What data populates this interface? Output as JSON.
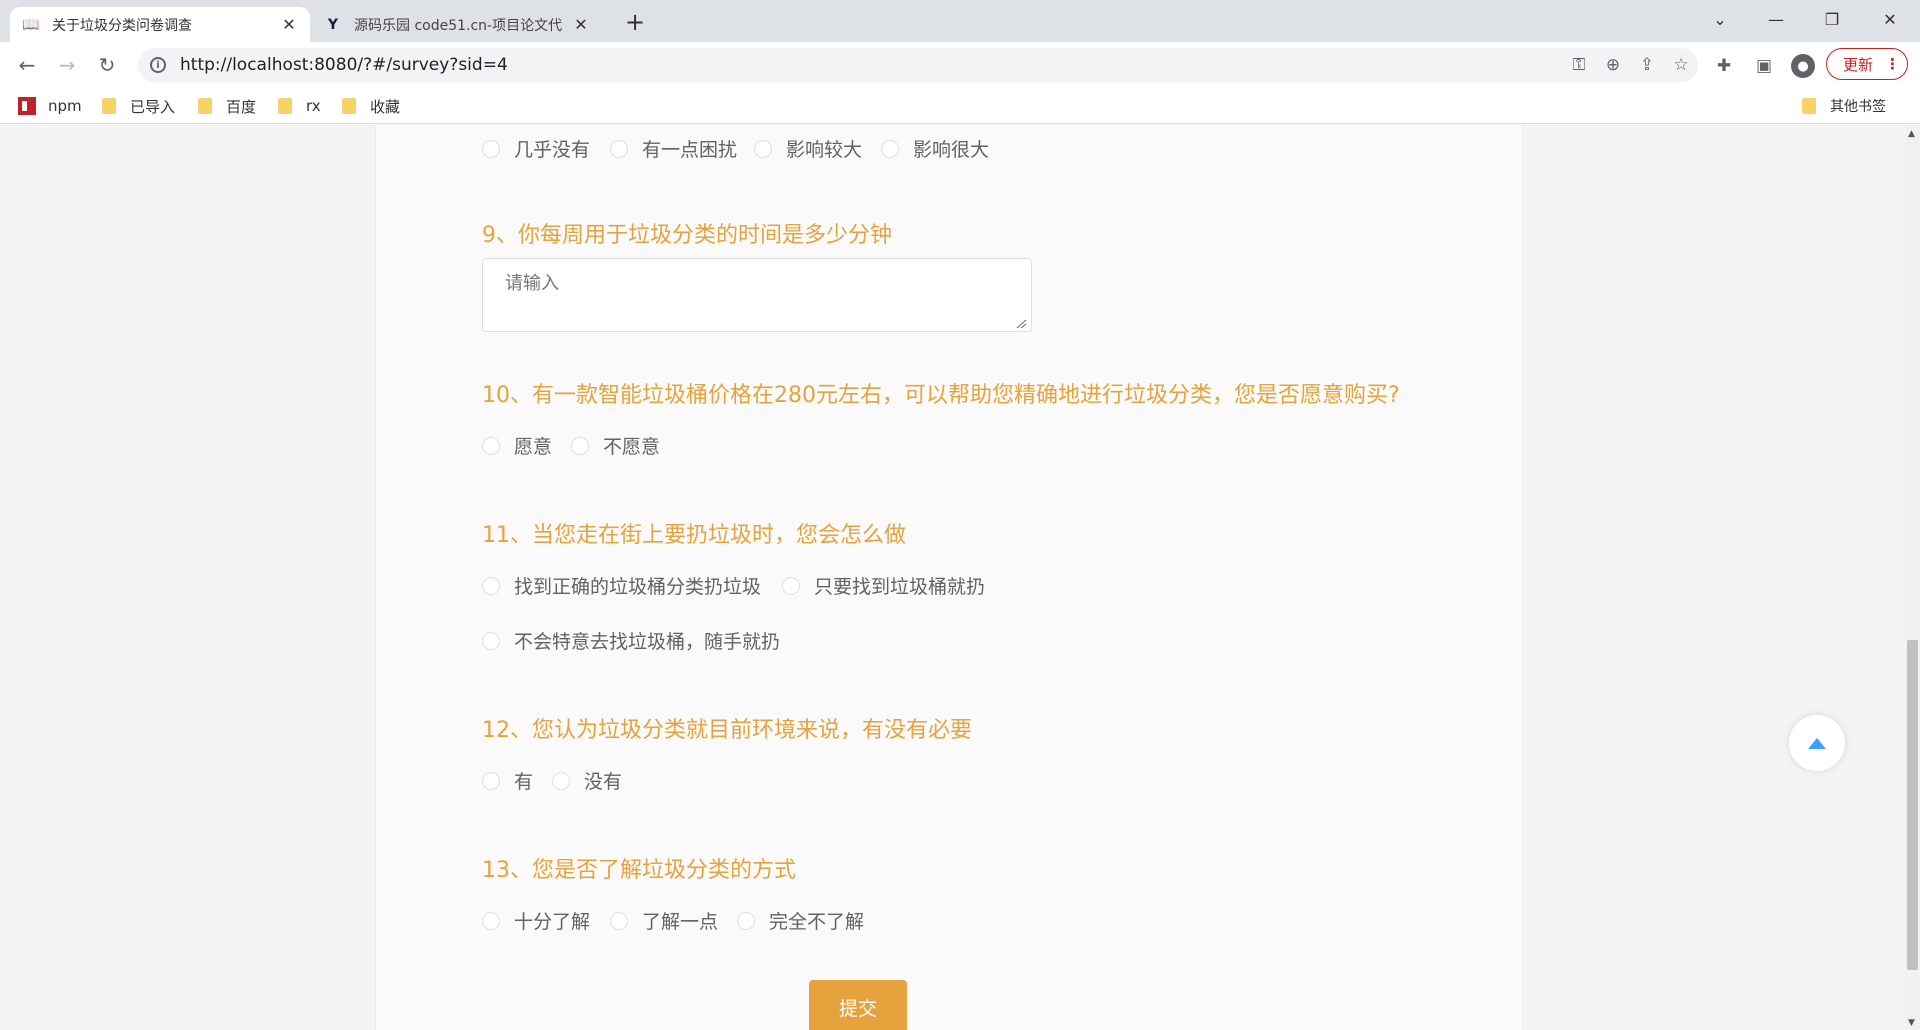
{
  "browser": {
    "tabs": [
      {
        "title": "关于垃圾分类问卷调查",
        "active": true
      },
      {
        "title": "源码乐园 code51.cn-项目论文代",
        "active": false
      }
    ],
    "new_tab": "+",
    "url": "http://localhost:8080/?#/survey?sid=4",
    "update_label": "更新",
    "bookmarks": [
      "npm",
      "已导入",
      "百度",
      "rx",
      "收藏"
    ],
    "other_bookmarks": "其他书签"
  },
  "survey": {
    "q8_options": [
      "几乎没有",
      "有一点困扰",
      "影响较大",
      "影响很大"
    ],
    "q9": {
      "title": "9、你每周用于垃圾分类的时间是多少分钟",
      "placeholder": "请输入"
    },
    "q10": {
      "title": "10、有一款智能垃圾桶价格在280元左右，可以帮助您精确地进行垃圾分类，您是否愿意购买?",
      "options": [
        "愿意",
        "不愿意"
      ]
    },
    "q11": {
      "title": "11、当您走在街上要扔垃圾时，您会怎么做",
      "options": [
        "找到正确的垃圾桶分类扔垃圾",
        "只要找到垃圾桶就扔",
        "不会特意去找垃圾桶，随手就扔"
      ]
    },
    "q12": {
      "title": "12、您认为垃圾分类就目前环境来说，有没有必要",
      "options": [
        "有",
        "没有"
      ]
    },
    "q13": {
      "title": "13、您是否了解垃圾分类的方式",
      "options": [
        "十分了解",
        "了解一点",
        "完全不了解"
      ]
    },
    "submit_label": "提交"
  },
  "colors": {
    "accent": "#e6a23c",
    "backtop": "#409eff"
  }
}
